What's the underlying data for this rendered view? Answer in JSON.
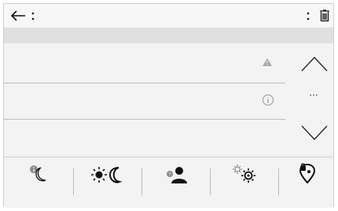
{
  "toolbar": {
    "back_icon": "arrow-left-icon",
    "menu_left_icon": "vertical-dots-icon",
    "menu_right_icon": "vertical-dots-icon",
    "delete_icon": "trash-icon"
  },
  "list": {
    "row1_icon": "warning-triangle-icon",
    "row2_icon": "info-circle-icon"
  },
  "pager": {
    "up_icon": "chevron-up-icon",
    "more_label": "···",
    "down_icon": "chevron-down-icon"
  },
  "tabs": [
    {
      "icon": "night-mode-icon"
    },
    {
      "icon": "day-night-icon"
    },
    {
      "icon": "user-unknown-icon"
    },
    {
      "icon": "settings-gears-icon"
    },
    {
      "icon": "location-lock-icon"
    }
  ],
  "colors": {
    "icon_dark": "#111111",
    "icon_light": "#8c8c8c",
    "divider": "#bdbdbd"
  }
}
